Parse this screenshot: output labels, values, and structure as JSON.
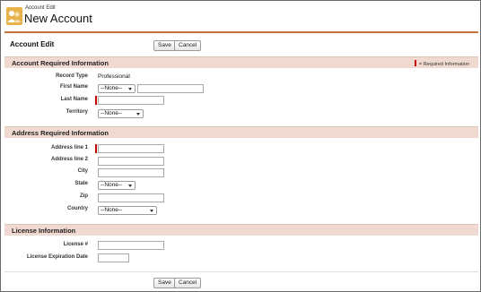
{
  "header": {
    "breadcrumb": "Account Edit",
    "title": "New Account"
  },
  "toolbar": {
    "edit_title": "Account Edit",
    "save_label": "Save",
    "cancel_label": "Cancel"
  },
  "sections": {
    "required": {
      "title": "Account Required Information",
      "legend": "= Required Information"
    },
    "address": {
      "title": "Address Required Information"
    },
    "license": {
      "title": "License Information"
    }
  },
  "fields": {
    "record_type": {
      "label": "Record Type",
      "value": "Professional"
    },
    "first_name": {
      "label": "First Name",
      "salutation": "--None--",
      "value": ""
    },
    "last_name": {
      "label": "Last Name",
      "value": ""
    },
    "territory": {
      "label": "Territory",
      "value": "--None--"
    },
    "address1": {
      "label": "Address line 1",
      "value": ""
    },
    "address2": {
      "label": "Address line 2",
      "value": ""
    },
    "city": {
      "label": "City",
      "value": ""
    },
    "state": {
      "label": "State",
      "value": "--None--"
    },
    "zip": {
      "label": "Zip",
      "value": ""
    },
    "country": {
      "label": "Country",
      "value": "--None--"
    },
    "license_no": {
      "label": "License #",
      "value": ""
    },
    "license_exp": {
      "label": "License Expiration Date",
      "value": ""
    }
  },
  "colors": {
    "accent": "#c4733f",
    "section_bg": "#f0d9d0",
    "required": "#cc0000"
  },
  "icons": {
    "app": "account-people-icon"
  }
}
